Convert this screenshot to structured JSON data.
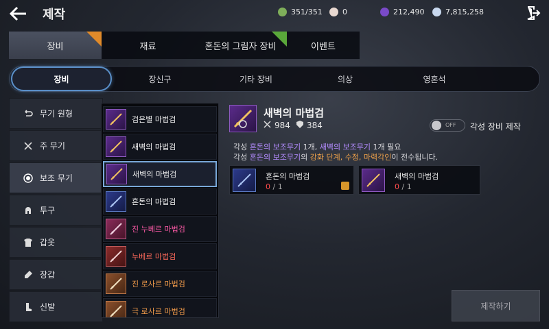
{
  "header": {
    "title": "제작",
    "resources": [
      {
        "icon": "stamina-icon",
        "value": "351/351",
        "color": "#7fae5a"
      },
      {
        "icon": "pearl-icon",
        "value": "0",
        "color": "#e8d8d0"
      },
      {
        "icon": "black-gem-icon",
        "value": "212,490",
        "color": "#7a4ac8"
      },
      {
        "icon": "silver-icon",
        "value": "7,815,258",
        "color": "#c8d8ee"
      }
    ]
  },
  "main_tabs": [
    {
      "label": "장비",
      "active": true,
      "badge": "orange"
    },
    {
      "label": "재료",
      "active": false
    },
    {
      "label": "혼돈의 그림자 장비",
      "active": false,
      "badge": "green"
    },
    {
      "label": "이벤트",
      "active": false
    }
  ],
  "sub_tabs": [
    "장비",
    "장신구",
    "기타 장비",
    "의상",
    "영혼석"
  ],
  "categories": [
    {
      "label": "무기 원형",
      "icon": "restore-icon"
    },
    {
      "label": "주 무기",
      "icon": "crossed-swords-icon"
    },
    {
      "label": "보조 무기",
      "icon": "target-icon",
      "active": true
    },
    {
      "label": "투구",
      "icon": "helmet-icon"
    },
    {
      "label": "갑옷",
      "icon": "armor-icon"
    },
    {
      "label": "장갑",
      "icon": "glove-icon"
    },
    {
      "label": "신발",
      "icon": "boot-icon"
    }
  ],
  "items": [
    {
      "name": "검은별 마법검",
      "color": "#f0f0f0",
      "thumb": "purple"
    },
    {
      "name": "새벽의 마법검",
      "color": "#f0f0f0",
      "thumb": "purple"
    },
    {
      "name": "새벽의 마법검",
      "color": "#f0f0f0",
      "thumb": "purple",
      "selected": true
    },
    {
      "name": "혼돈의 마법검",
      "color": "#f0f0f0",
      "thumb": "blue"
    },
    {
      "name": "진 누베르 마법검",
      "color": "#ff5aa8",
      "thumb": "pink"
    },
    {
      "name": "누베르 마법검",
      "color": "#ff6a5a",
      "thumb": "red"
    },
    {
      "name": "진 로사르 마법검",
      "color": "#f09a4a",
      "thumb": "orange"
    },
    {
      "name": "극 로사르 마법검",
      "color": "#f09a4a",
      "thumb": "orange"
    }
  ],
  "detail": {
    "name": "새벽의 마법검",
    "attack": "984",
    "defense": "384",
    "awaken_toggle": "OFF",
    "awaken_label": "각성 장비 제작",
    "req_line1": {
      "p1": "각성 ",
      "h1": "혼돈의 보조무기",
      "p2": " 1개, ",
      "h2": "새벽의 보조무기",
      "p3": " 1개 필요"
    },
    "req_line2": {
      "p1": "각성 ",
      "h1": "혼돈의 보조무기",
      "p2": "의 ",
      "h2": "강화 단계, 수정, 마력각인",
      "p3": "이 전수됩니다."
    }
  },
  "materials": [
    {
      "name": "혼돈의 마법검",
      "have": "0",
      "need": "1"
    },
    {
      "name": "새벽의 마법검",
      "have": "0",
      "need": "1"
    }
  ],
  "craft_button": "제작하기",
  "colors": {
    "accent": "#5a8fc8",
    "selected_border": "#79a8d8",
    "missing": "#ff4b4b"
  }
}
